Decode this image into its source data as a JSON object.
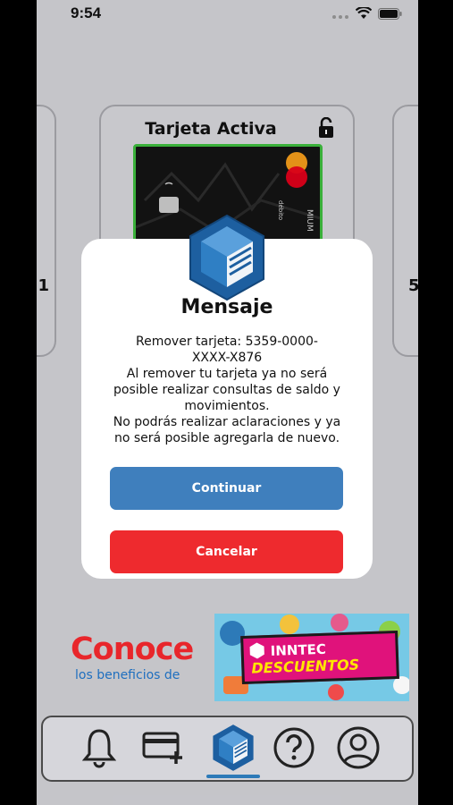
{
  "status_bar": {
    "time": "9:54"
  },
  "card": {
    "title": "Tarjeta Activa",
    "left_digit": "1",
    "right_digit": "5"
  },
  "modal": {
    "title": "Mensaje",
    "body_lines": [
      "Remover tarjeta: 5359-0000-",
      "XXXX-X876",
      "Al remover tu tarjeta ya no será",
      "posible realizar consultas de saldo y",
      "movimientos.",
      "No podrás realizar aclaraciones y ya",
      "no será posible agregarla de nuevo."
    ],
    "continue_label": "Continuar",
    "cancel_label": "Cancelar"
  },
  "banner": {
    "headline": "Conoce",
    "subline": "los beneficios de",
    "brand": "INNTEC",
    "badge": "DESCUENTOS"
  },
  "tabbar": {
    "tabs": [
      {
        "icon": "bell-icon"
      },
      {
        "icon": "add-card-icon"
      },
      {
        "icon": "inntec-logo-icon"
      },
      {
        "icon": "help-icon"
      },
      {
        "icon": "profile-icon"
      }
    ],
    "active_index": 2
  },
  "colors": {
    "primary_blue": "#3f7fbd",
    "danger_red": "#ee2a2e",
    "active_card_border": "#3fbf3f"
  }
}
